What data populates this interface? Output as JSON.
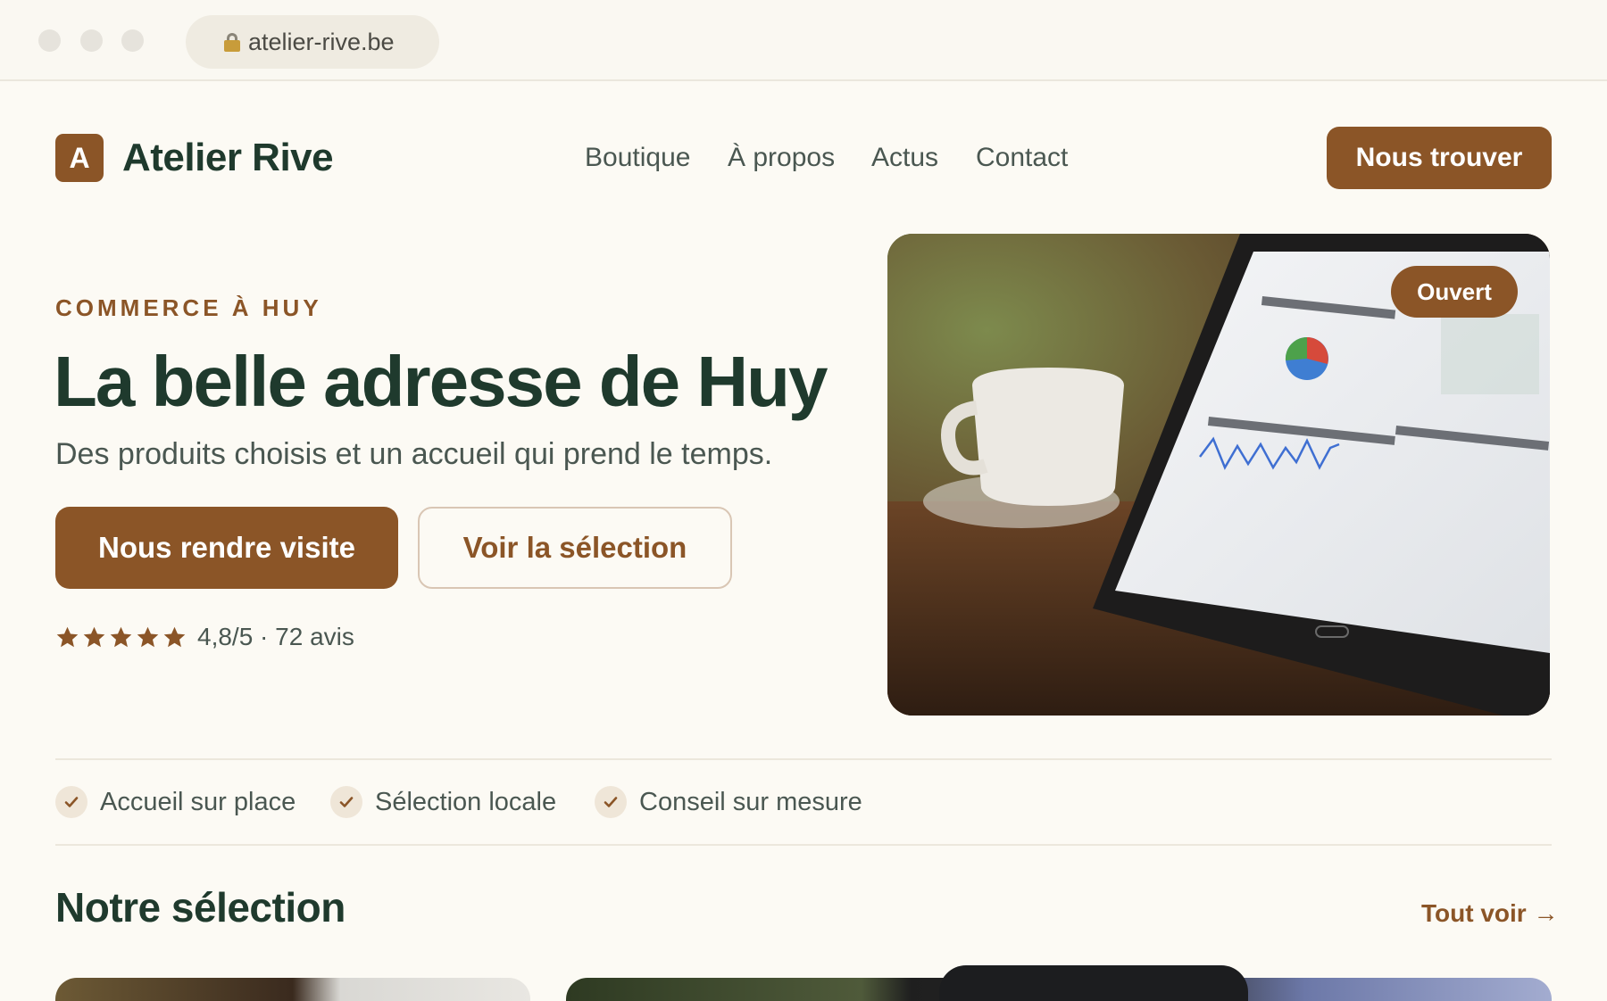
{
  "browser": {
    "url": "atelier-rive.be"
  },
  "header": {
    "logo_letter": "A",
    "brand": "Atelier Rive",
    "nav": [
      "Boutique",
      "À propos",
      "Actus",
      "Contact"
    ],
    "cta": "Nous trouver"
  },
  "hero": {
    "eyebrow": "COMMERCE À HUY",
    "title": "La belle adresse de Huy",
    "subtitle": "Des produits choisis et un accueil qui prend le temps.",
    "primary_button": "Nous rendre visite",
    "secondary_button": "Voir la sélection",
    "rating": {
      "stars": 5,
      "text": "4,8/5 · 72 avis"
    },
    "badge": "Ouvert"
  },
  "features": [
    "Accueil sur place",
    "Sélection locale",
    "Conseil sur mesure"
  ],
  "selection": {
    "title": "Notre sélection",
    "see_all": "Tout voir →"
  },
  "colors": {
    "accent": "#8b5527",
    "heading": "#1f3a2d",
    "background": "#fcfaf4"
  }
}
